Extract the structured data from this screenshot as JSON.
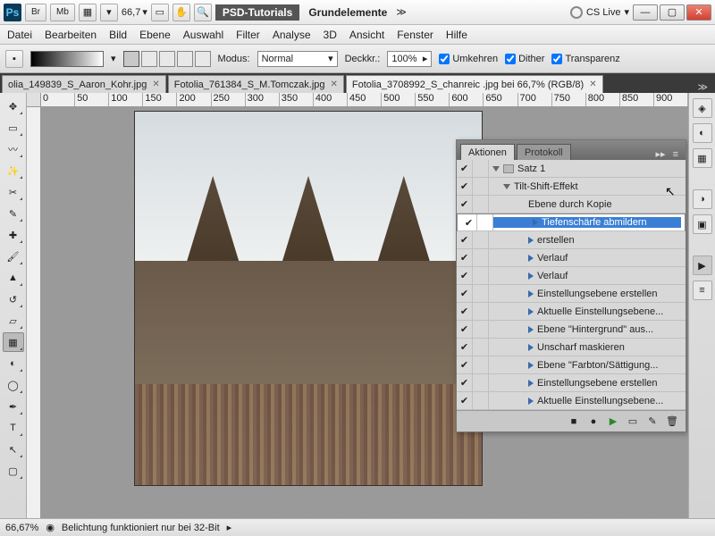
{
  "titlebar": {
    "br": "Br",
    "mb": "Mb",
    "zoom": "66,7",
    "workspace": "PSD-Tutorials",
    "preset": "Grundelemente",
    "cslive": "CS Live"
  },
  "menu": [
    "Datei",
    "Bearbeiten",
    "Bild",
    "Ebene",
    "Auswahl",
    "Filter",
    "Analyse",
    "3D",
    "Ansicht",
    "Fenster",
    "Hilfe"
  ],
  "options": {
    "modus_label": "Modus:",
    "modus_value": "Normal",
    "deck_label": "Deckkr.:",
    "deck_value": "100%",
    "umkehren": "Umkehren",
    "dither": "Dither",
    "transparenz": "Transparenz"
  },
  "tabs": [
    {
      "label": "olia_149839_S_Aaron_Kohr.jpg",
      "active": false
    },
    {
      "label": "Fotolia_761384_S_M.Tomczak.jpg",
      "active": false
    },
    {
      "label": "Fotolia_3708992_S_chanreic .jpg bei 66,7% (RGB/8)",
      "active": true
    }
  ],
  "ruler": [
    "0",
    "50",
    "100",
    "150",
    "200",
    "250",
    "300",
    "350",
    "400",
    "450",
    "500",
    "550",
    "600",
    "650",
    "700",
    "750",
    "800",
    "850",
    "900"
  ],
  "panel": {
    "tabs": [
      "Aktionen",
      "Protokoll"
    ],
    "set": "Satz 1",
    "action": "Tilt-Shift-Effekt",
    "steps": [
      "Ebene durch Kopie",
      "Tiefenschärfe abmildern",
      "erstellen",
      "Verlauf",
      "Verlauf",
      "Einstellungsebene erstellen",
      "Aktuelle Einstellungsebene...",
      "Ebene \"Hintergrund\" aus...",
      "Unscharf maskieren",
      "Ebene \"Farbton/Sättigung...",
      "Einstellungsebene erstellen",
      "Aktuelle Einstellungsebene..."
    ],
    "selected": 1
  },
  "status": {
    "zoom": "66,67%",
    "msg": "Belichtung funktioniert nur bei 32-Bit"
  }
}
